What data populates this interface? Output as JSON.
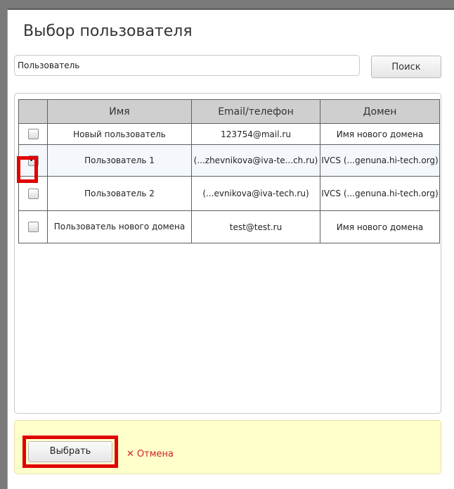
{
  "dialog": {
    "title": "Выбор пользователя"
  },
  "search": {
    "value": "Пользователь",
    "button_label": "Поиск"
  },
  "table": {
    "headers": [
      "Имя",
      "Email/телефон",
      "Домен"
    ],
    "rows": [
      {
        "checked": false,
        "name": "Новый пользователь",
        "email": "123754@mail.ru",
        "domain": "Имя нового домена"
      },
      {
        "checked": true,
        "name": "Пользователь 1",
        "email": "(...zhevnikova@iva-te...ch.ru)",
        "domain": "IVCS (...genuna.hi-tech.org)"
      },
      {
        "checked": false,
        "name": "Пользователь 2",
        "email": "(...evnikova@iva-tech.ru)",
        "domain": "IVCS (...genuna.hi-tech.org)"
      },
      {
        "checked": false,
        "name": "Пользователь нового домена",
        "email": "test@test.ru",
        "domain": "Имя нового домена"
      }
    ]
  },
  "footer": {
    "select_label": "Выбрать",
    "cancel_label": "Отмена",
    "cancel_icon": "close-icon"
  },
  "colors": {
    "highlight": "#e00000",
    "footer_bg": "#ffffcc",
    "cancel": "#cc2222"
  }
}
